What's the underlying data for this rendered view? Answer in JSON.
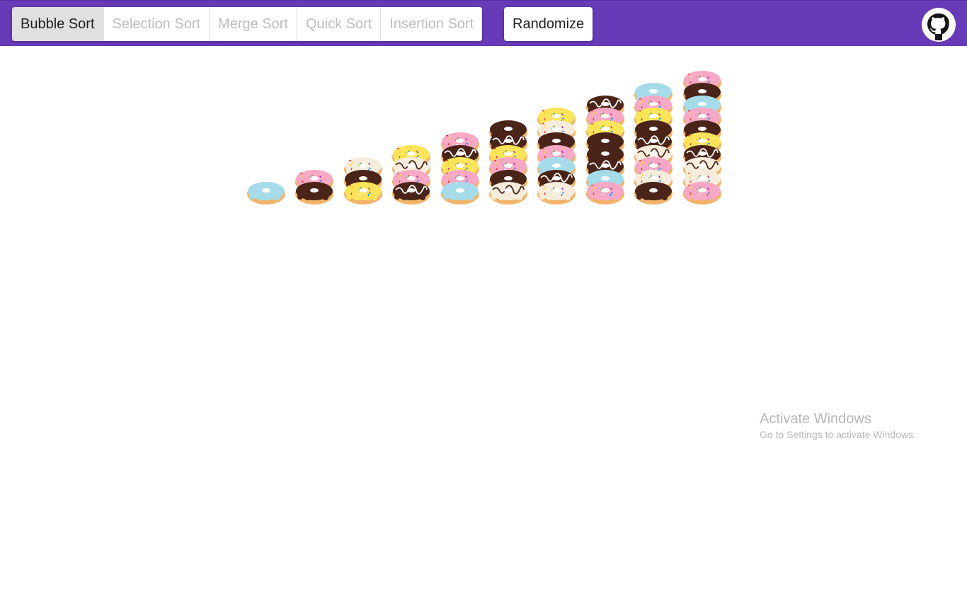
{
  "toolbar": {
    "algorithms": [
      {
        "label": "Bubble Sort",
        "active": true
      },
      {
        "label": "Selection Sort",
        "active": false
      },
      {
        "label": "Merge Sort",
        "active": false
      },
      {
        "label": "Quick Sort",
        "active": false
      },
      {
        "label": "Insertion Sort",
        "active": false
      }
    ],
    "randomize_label": "Randomize",
    "github_icon": "github-icon",
    "bar_color": "#673ab7"
  },
  "chart_data": {
    "type": "bar",
    "values": [
      1,
      2,
      3,
      4,
      5,
      6,
      7,
      8,
      9,
      10
    ],
    "stacks": [
      [
        "blue"
      ],
      [
        "choc",
        "pink"
      ],
      [
        "yellow",
        "choc",
        "white"
      ],
      [
        "choc-drizzle",
        "pink",
        "white-drizzle",
        "yellow"
      ],
      [
        "blue",
        "pink",
        "yellow",
        "choc-drizzle",
        "pink"
      ],
      [
        "white-drizzle",
        "choc",
        "pink",
        "yellow",
        "choc-drizzle",
        "choc"
      ],
      [
        "white",
        "choc-drizzle",
        "blue",
        "pink",
        "choc",
        "white",
        "yellow"
      ],
      [
        "pink",
        "blue",
        "choc-drizzle",
        "choc",
        "choc",
        "yellow",
        "pink",
        "choc-drizzle"
      ],
      [
        "choc",
        "white",
        "pink",
        "white-drizzle",
        "choc-drizzle",
        "choc",
        "yellow",
        "pink",
        "blue"
      ],
      [
        "pink",
        "white",
        "white-drizzle",
        "choc-drizzle",
        "yellow",
        "choc",
        "pink",
        "blue",
        "choc",
        "pink"
      ]
    ],
    "icing_colors": {
      "blue": "#a6dcea",
      "pink": "#f7a8c4",
      "yellow": "#fbe35a",
      "choc": "#4a2418",
      "white": "#f6ecdc",
      "choc-drizzle": "#4a2418",
      "white-drizzle": "#f6ecdc",
      "dough": "#f1b46a"
    }
  },
  "watermark": {
    "title": "Activate Windows",
    "subtitle": "Go to Settings to activate Windows."
  }
}
